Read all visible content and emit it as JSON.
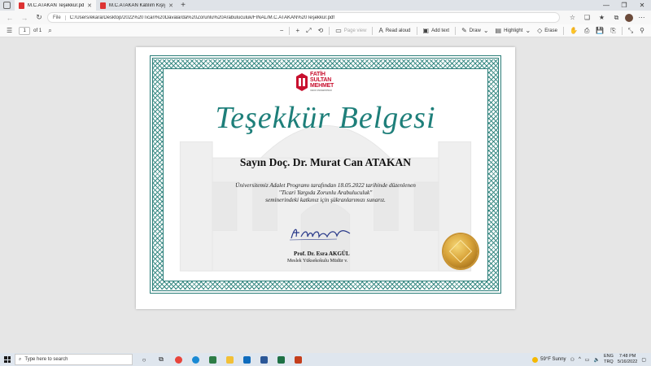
{
  "browser": {
    "tabs": [
      {
        "label": "M.C.ATAKAN Teşekkür.pdf",
        "active": true
      },
      {
        "label": "M.C.ATAKAN Katılım Kişiy.pdf",
        "active": false
      }
    ],
    "new_tab": "+",
    "address": {
      "scheme_label": "File",
      "url": "C:/Users/ekara/Desktop/2022%20Ticari%20Davalarda%20Zorunlu%20Arabuluculuk/FINAL/M.C.ATAKAN%20Teşekkür.pdf"
    }
  },
  "pdf_toolbar": {
    "page_number": "1",
    "page_total": "of 1",
    "zoom_out": "−",
    "zoom_in": "+",
    "page_view": "Page view",
    "read_aloud": "Read aloud",
    "add_text": "Add text",
    "draw": "Draw",
    "highlight": "Highlight",
    "erase": "Erase"
  },
  "certificate": {
    "logo_line1": "FATİH",
    "logo_line2": "SULTAN",
    "logo_line3": "MEHMET",
    "logo_sub": "VAKIF ÜNİVERSİTESİ",
    "title": "Teşekkür Belgesi",
    "recipient": "Sayın Doç. Dr. Murat Can ATAKAN",
    "body_line1": "Üniversitemiz Adalet Programı tarafından 18.05.2022 tarihinde düzenlenen",
    "body_line2": "\"Ticari Yargıda Zorunlu Arabuluculuk\"",
    "body_line3": "seminerindeki katkınız için şükranlarımızı sunarız.",
    "signer_name": "Prof. Dr. Esra AKGÜL",
    "signer_title": "Meslek Yüksekokulu Müdür v."
  },
  "taskbar": {
    "search_placeholder": "Type here to search",
    "weather": "59°F  Sunny",
    "lang_top": "ENG",
    "lang_bottom": "TRQ",
    "time": "7:48 PM",
    "date": "5/16/2022"
  },
  "colors": {
    "teal": "#1e7f7a",
    "brand_red": "#c8102e",
    "gold": "#d9a43a"
  }
}
